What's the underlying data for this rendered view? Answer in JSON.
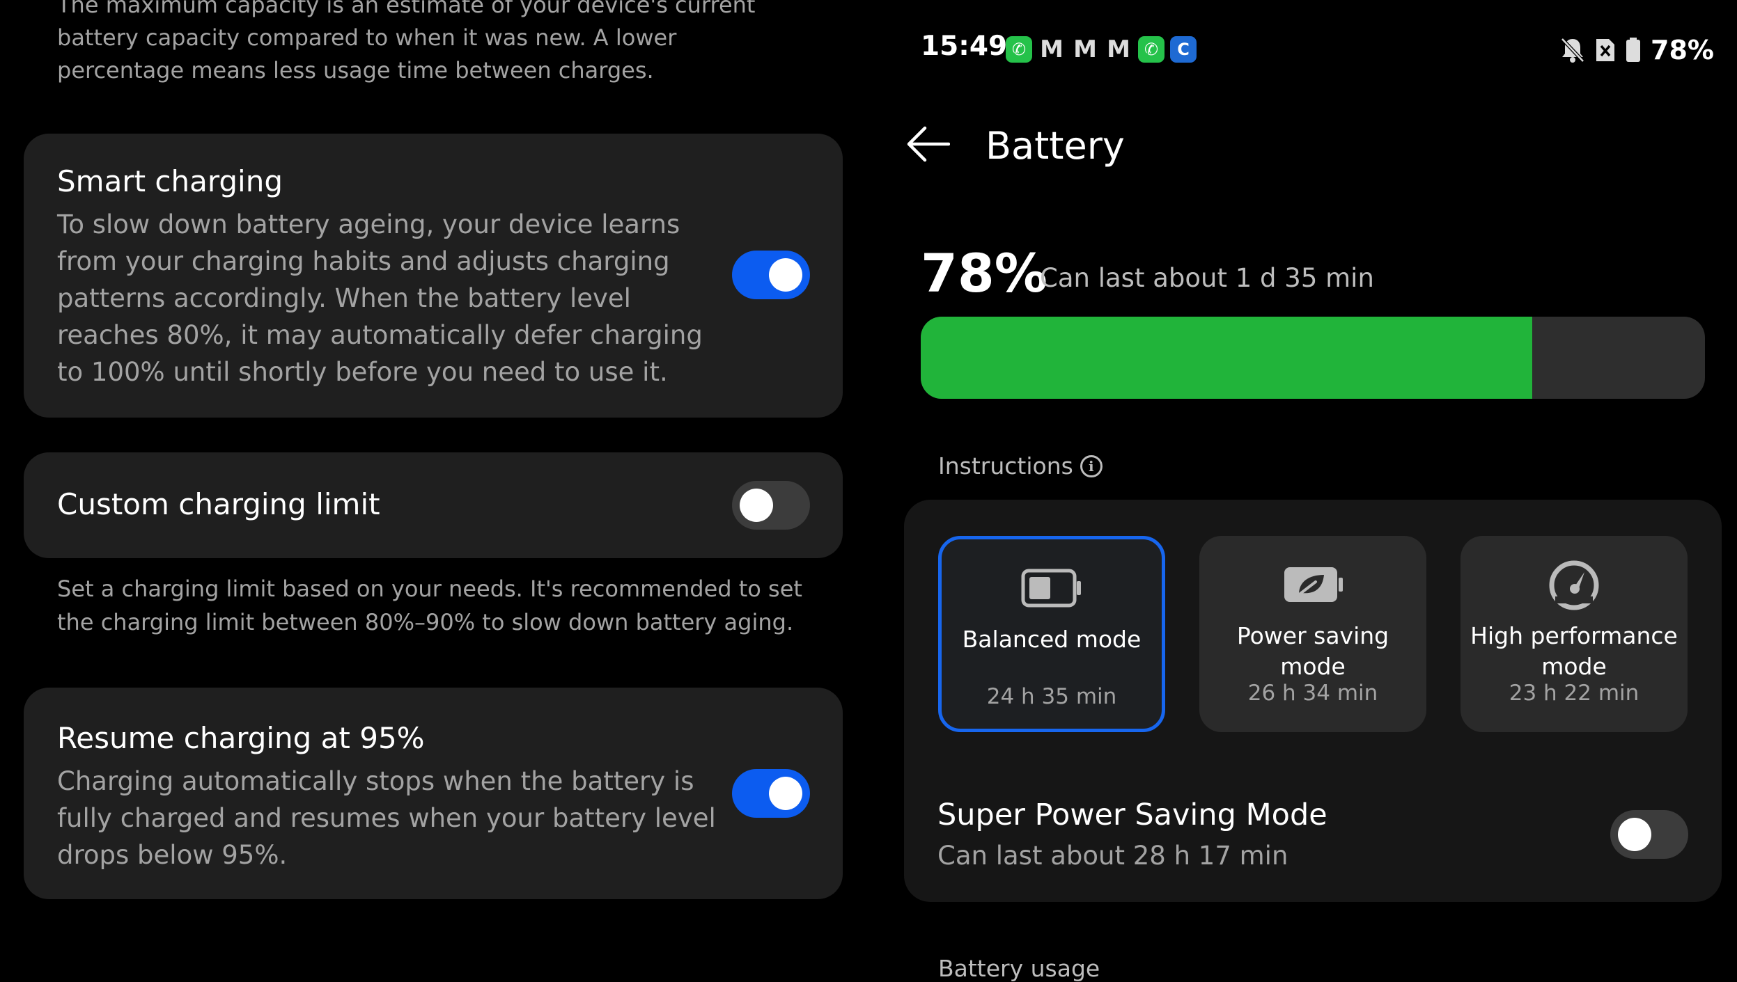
{
  "left": {
    "intro_text": "The maximum capacity is an estimate of your device's current battery capacity compared to when it was new. A lower percentage means less usage time between charges.",
    "smart_charging": {
      "title": "Smart charging",
      "description": "To slow down battery ageing, your device learns from your charging habits and adjusts charging patterns accordingly. When the battery level reaches 80%, it may automatically defer charging to 100% until shortly before you need to use it.",
      "enabled": true
    },
    "custom_limit": {
      "title": "Custom charging limit",
      "enabled": false,
      "note": "Set a charging limit based on your needs. It's recommended to set the charging limit between 80%–90% to slow down battery aging."
    },
    "resume_charging": {
      "title": "Resume charging at 95%",
      "description": "Charging automatically stops when the battery is fully charged and resumes when your battery level drops below 95%.",
      "enabled": true
    }
  },
  "status_bar": {
    "time": "15:49",
    "notification_icons": [
      "whatsapp-icon",
      "gmail-icon",
      "gmail-icon",
      "gmail-icon",
      "whatsapp-icon",
      "chrome-icon"
    ],
    "right_icons": [
      "bell-off-icon",
      "no-sim-icon",
      "battery-icon"
    ],
    "battery_percent": "78%"
  },
  "header": {
    "title": "Battery"
  },
  "battery": {
    "percent_label": "78%",
    "level_fraction": 0.78,
    "last_about": "Can last about 1 d 35 min"
  },
  "instructions": {
    "label": "Instructions"
  },
  "modes": [
    {
      "name": "Balanced mode",
      "time": "24 h 35 min",
      "icon": "battery-half-icon",
      "selected": true
    },
    {
      "name": "Power saving mode",
      "time": "26 h 34 min",
      "icon": "battery-leaf-icon",
      "selected": false
    },
    {
      "name": "High performance mode",
      "time": "23 h 22 min",
      "icon": "speedometer-icon",
      "selected": false
    }
  ],
  "super_power_saving": {
    "title": "Super Power Saving Mode",
    "subtitle": "Can last about 28 h 17 min",
    "enabled": false
  },
  "battery_usage": {
    "label": "Battery usage"
  },
  "colors": {
    "accent": "#0c5cf0",
    "battery_fill": "#21b43a",
    "card_bg": "#1f1f1f"
  }
}
